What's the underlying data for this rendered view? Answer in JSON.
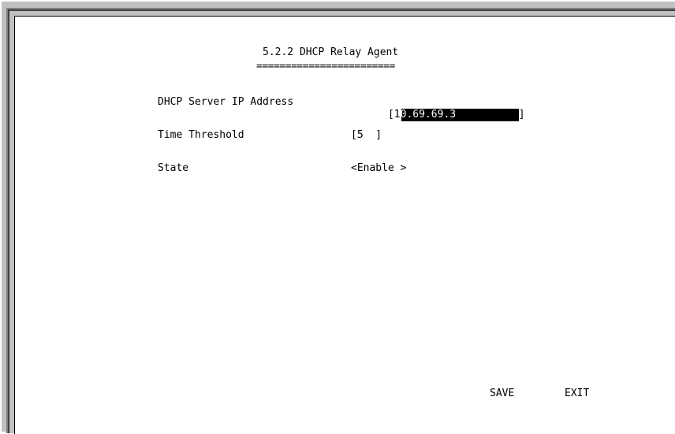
{
  "menu": {
    "title": "5.2.2 DHCP Relay Agent",
    "title_underline": "========================"
  },
  "fields": {
    "server_ip": {
      "label": "DHCP Server IP Address",
      "value": "10.69.69.3",
      "open_bracket": "[",
      "close_bracket": "]"
    },
    "time_threshold": {
      "label": "Time Threshold",
      "value": "[5  ]"
    },
    "state": {
      "label": "State",
      "value": "<Enable >"
    }
  },
  "actions": {
    "save": "SAVE",
    "exit": "EXIT"
  },
  "colors": {
    "frame": "#c0c0c0",
    "screen_bg": "#ffffff",
    "text": "#000000",
    "highlight": "#000000"
  }
}
